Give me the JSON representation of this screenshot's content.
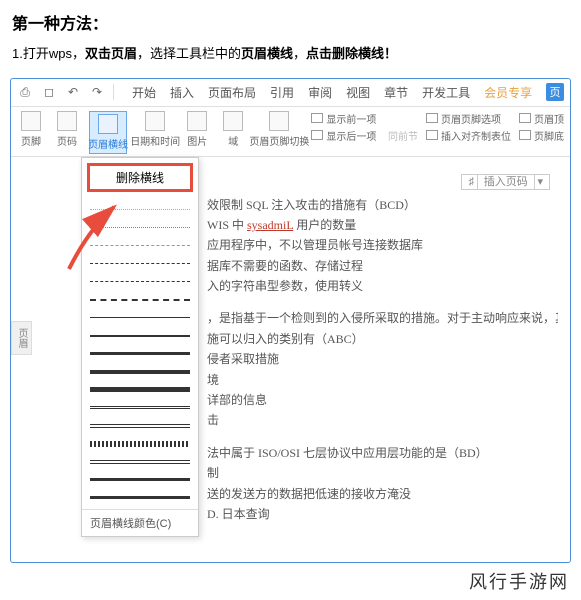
{
  "heading": "第一种方法：",
  "instruction": {
    "p1": "1.打开wps，",
    "b1": "双击页眉",
    "p2": "，选择工具栏中的",
    "b2": "页眉横线",
    "p3": "，",
    "b3": "点击删除横线！"
  },
  "menus": [
    "开始",
    "插入",
    "页面布局",
    "引用",
    "审阅",
    "视图",
    "章节",
    "开发工具",
    "会员专享"
  ],
  "blue_badge": "页",
  "ribbon": {
    "g1": "页脚",
    "g2": "页码",
    "g3": "页眉横线",
    "g4": "日期和时间",
    "g5": "图片",
    "g6": "域",
    "g7": "页眉页脚切换",
    "s1": "显示前一项",
    "s2": "显示后一项",
    "s3": "同前节",
    "s4": "页眉页脚选项",
    "s5": "插入对齐制表位",
    "s6": "页眉顶",
    "s7": "页脚底"
  },
  "dropdown": {
    "delete": "删除横线",
    "footer": "页眉横线颜色(C)"
  },
  "side_tab": "页眉",
  "insert_label": "插入页码",
  "doc": {
    "l1": "效限制 SQL 注入攻击的措施有（BCD）",
    "l2": "WIS 中 ",
    "l2b": "sysadmiL",
    "l2c": " 用户的数量",
    "l3": "应用程序中，不以管理员帐号连接数据库",
    "l4": "据库不需要的函数、存储过程",
    "l5": "入的字符串型参数，使用转义",
    "l6": "，是指基于一个检则到的入侵所采取的措施。对于主动响应来说，其",
    "l7": "施可以归入的类别有（ABC）",
    "l8": "侵者采取措施",
    "l9": "境",
    "l10": "详部的信息",
    "l11": "击",
    "l12": "法中属于 ISO/OSI 七层协议中应用层功能的是（BD）",
    "l13": "制",
    "l14": "送的发送方的数据把低速的接收方淹没",
    "l15": "D. 日本查询"
  },
  "watermark": "风行手游网"
}
